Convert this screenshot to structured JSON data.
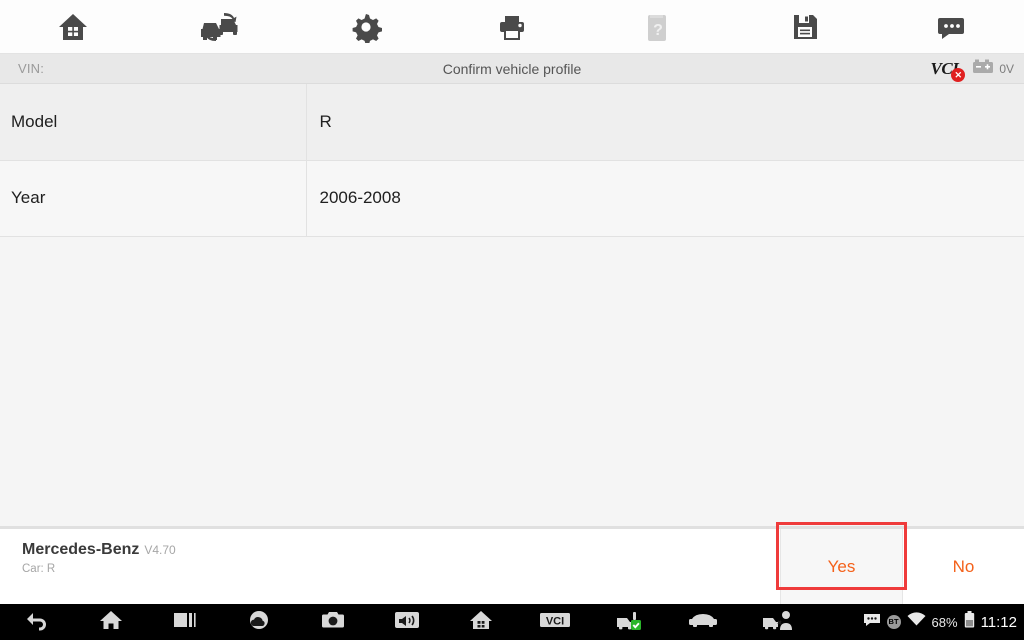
{
  "toolbar": {
    "items": [
      {
        "name": "home-icon",
        "label": "Home"
      },
      {
        "name": "change-vehicle-icon",
        "label": "Change vehicle"
      },
      {
        "name": "gear-icon",
        "label": "Settings"
      },
      {
        "name": "printer-icon",
        "label": "Print"
      },
      {
        "name": "help-book-icon",
        "label": "Help",
        "disabled": true
      },
      {
        "name": "save-floppy-icon",
        "label": "Save"
      },
      {
        "name": "chat-bubble-icon",
        "label": "Messages"
      }
    ]
  },
  "subheader": {
    "vin_label": "VIN:",
    "vin_value": "",
    "title": "Confirm vehicle profile",
    "vci_label": "VCI",
    "vci_status": "disconnected",
    "vci_badge": "✕",
    "battery_voltage": "0V",
    "battery_icon": "car-battery-icon"
  },
  "table": {
    "rows": [
      {
        "key": "Model",
        "value": "R"
      },
      {
        "key": "Year",
        "value": "2006-2008"
      }
    ]
  },
  "bottom": {
    "vehicle_name": "Mercedes-Benz",
    "version": "V4.70",
    "sub_label": "Car: R",
    "yes_label": "Yes",
    "no_label": "No",
    "highlight_color": "#ef3b3b",
    "accent_color": "#f4611a"
  },
  "navbar": {
    "items": [
      {
        "name": "back-icon"
      },
      {
        "name": "home-icon"
      },
      {
        "name": "recents-icon"
      },
      {
        "name": "cloud-icon"
      },
      {
        "name": "camera-icon"
      },
      {
        "name": "screenshot-record-icon"
      },
      {
        "name": "house-app-icon"
      },
      {
        "name": "vci-app-icon"
      },
      {
        "name": "vehicle-connected-icon"
      },
      {
        "name": "car-icon"
      },
      {
        "name": "car-service-icon"
      }
    ],
    "vci_label": "VCI",
    "tray": {
      "message_icon": "chat-bubble-icon",
      "bluetooth_label": "BT",
      "wifi_icon": "wifi-icon",
      "battery_percent": "68%",
      "time": "11:12"
    }
  }
}
